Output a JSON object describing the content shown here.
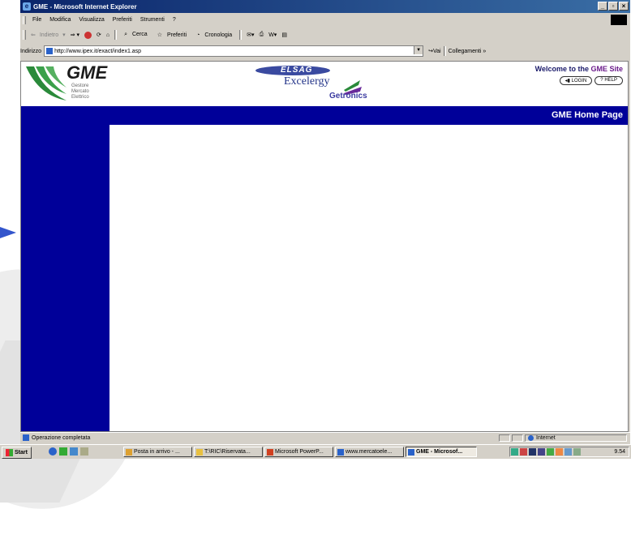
{
  "browser": {
    "title": "GME - Microsoft Internet Explorer",
    "menu": [
      "File",
      "Modifica",
      "Visualizza",
      "Preferiti",
      "Strumenti",
      "?"
    ],
    "toolbar": {
      "back": "Indietro",
      "search": "Cerca",
      "favorites": "Preferiti",
      "history": "Cronologia"
    },
    "address_label": "Indirizzo",
    "url": "http://www.ipex.it/exact/index1.asp",
    "go_label": "Vai",
    "links_label": "Collegamenti",
    "status_text": "Operazione completata",
    "zone": "Internet"
  },
  "site": {
    "logo_text": "GME",
    "logo_sub": [
      "Gestore",
      "Mercato",
      "Elettrico"
    ],
    "sponsors": [
      "ELSAG",
      "Excelergy",
      "Getronics"
    ],
    "welcome_prefix": "Welcome to the ",
    "welcome_site": "GME Site",
    "login_label": "LOGIN",
    "help_label": "HELP",
    "page_title": "GME Home Page"
  },
  "taskbar": {
    "start": "Start",
    "tasks": [
      "Posta in arrivo - ...",
      "T:\\RIC\\Riservata...",
      "Microsoft PowerP...",
      "www.mercatoele...",
      "GME - Microsof..."
    ],
    "clock": "9.54"
  }
}
